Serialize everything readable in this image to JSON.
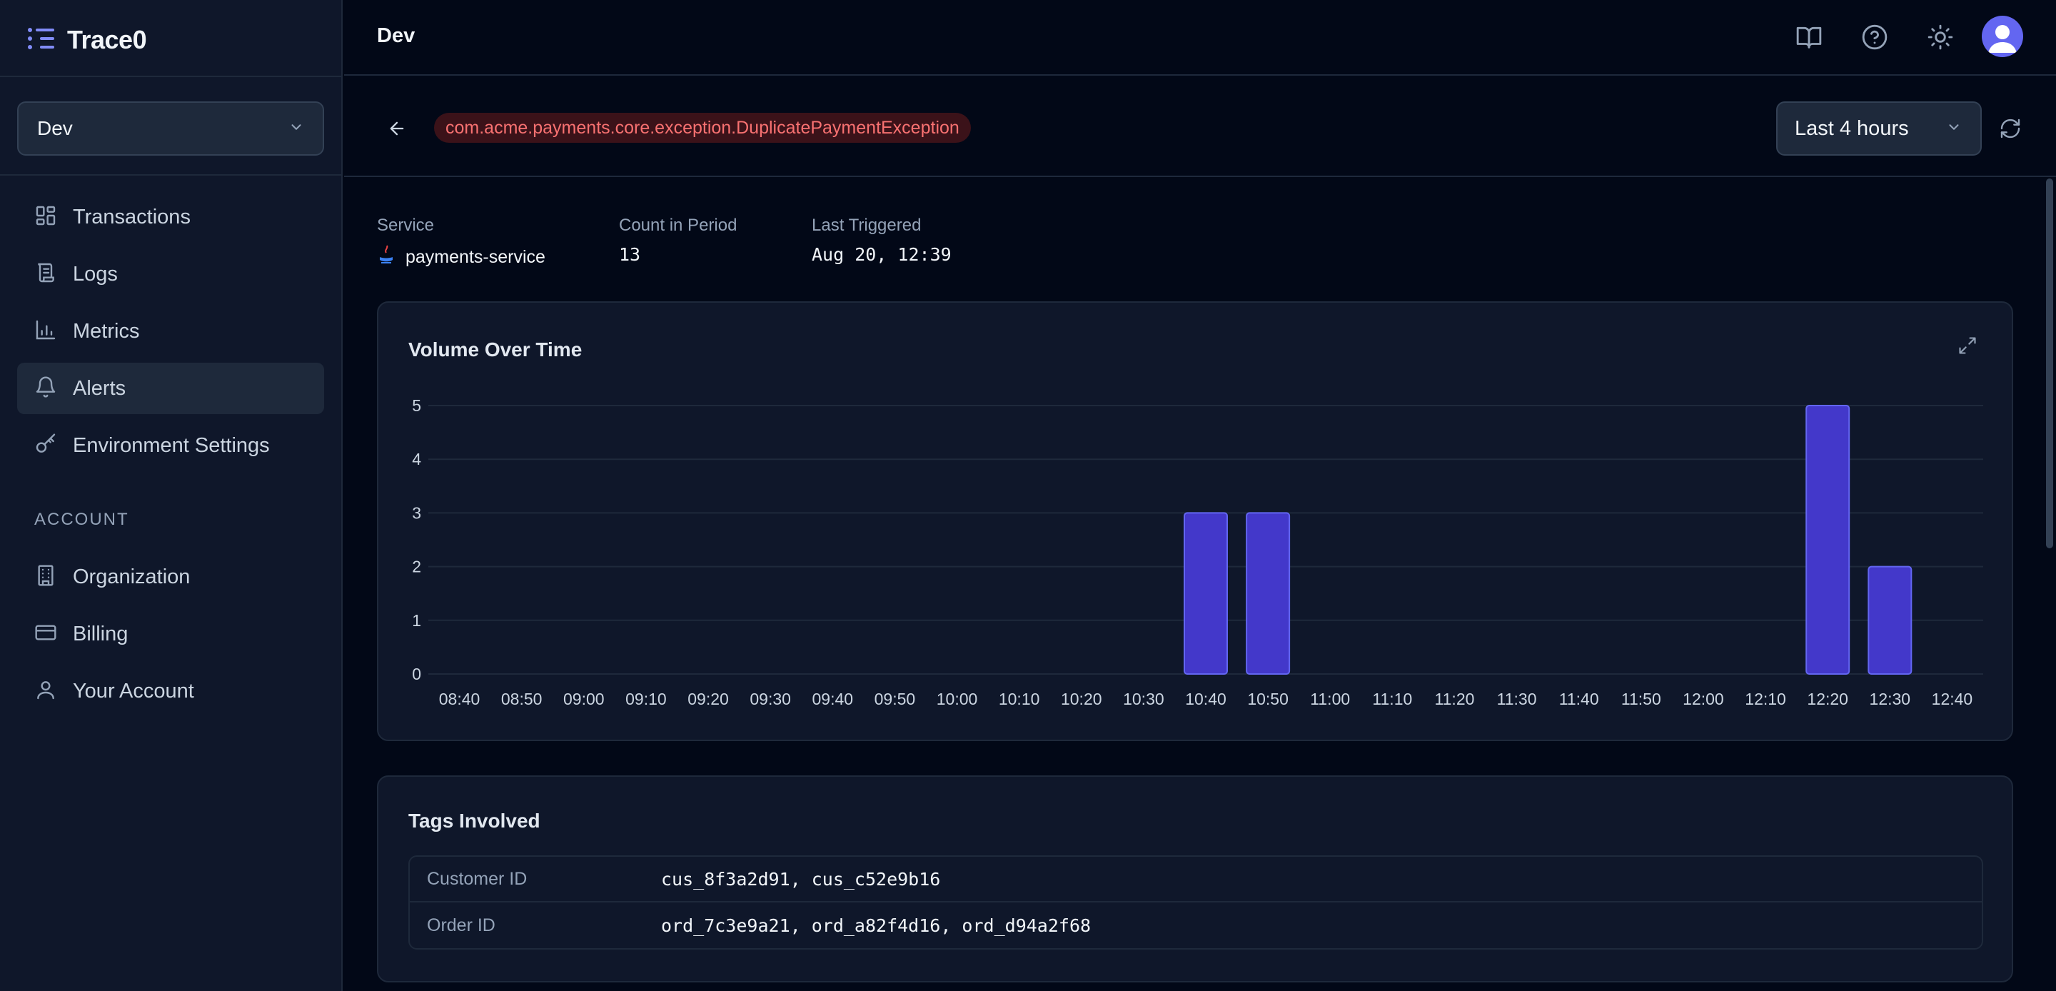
{
  "app": {
    "name": "Trace0"
  },
  "sidebar": {
    "environment": "Dev",
    "items": [
      {
        "label": "Transactions",
        "icon": "dashboard-icon",
        "active": false
      },
      {
        "label": "Logs",
        "icon": "scroll-icon",
        "active": false
      },
      {
        "label": "Metrics",
        "icon": "bar-chart-icon",
        "active": false
      },
      {
        "label": "Alerts",
        "icon": "bell-icon",
        "active": true
      },
      {
        "label": "Environment Settings",
        "icon": "key-icon",
        "active": false
      }
    ],
    "account_label": "ACCOUNT",
    "account_items": [
      {
        "label": "Organization",
        "icon": "building-icon"
      },
      {
        "label": "Billing",
        "icon": "credit-card-icon"
      },
      {
        "label": "Your Account",
        "icon": "user-icon"
      }
    ]
  },
  "header": {
    "title": "Dev",
    "icons": [
      "book-icon",
      "help-icon",
      "sun-icon",
      "avatar"
    ]
  },
  "detail": {
    "exception": "com.acme.payments.core.exception.DuplicatePaymentException",
    "time_range": "Last 4 hours",
    "service_label": "Service",
    "service": "payments-service",
    "count_label": "Count in Period",
    "count": "13",
    "last_label": "Last Triggered",
    "last": "Aug 20, 12:39"
  },
  "chart_card": {
    "title": "Volume Over Time"
  },
  "chart_data": {
    "type": "bar",
    "title": "Volume Over Time",
    "categories": [
      "08:40",
      "08:50",
      "09:00",
      "09:10",
      "09:20",
      "09:30",
      "09:40",
      "09:50",
      "10:00",
      "10:10",
      "10:20",
      "10:30",
      "10:40",
      "10:50",
      "11:00",
      "11:10",
      "11:20",
      "11:30",
      "11:40",
      "11:50",
      "12:00",
      "12:10",
      "12:20",
      "12:30",
      "12:40"
    ],
    "values": [
      0,
      0,
      0,
      0,
      0,
      0,
      0,
      0,
      0,
      0,
      0,
      0,
      3,
      3,
      0,
      0,
      0,
      0,
      0,
      0,
      0,
      0,
      5,
      2,
      0
    ],
    "yticks": [
      0,
      1,
      2,
      3,
      4,
      5
    ],
    "ylim": [
      0,
      5
    ],
    "grid": true,
    "bar_color": "#4338ca",
    "bar_border": "#6366f1"
  },
  "tags": {
    "title": "Tags Involved",
    "rows": [
      {
        "key": "Customer ID",
        "value": "cus_8f3a2d91, cus_c52e9b16"
      },
      {
        "key": "Order ID",
        "value": "ord_7c3e9a21, ord_a82f4d16, ord_d94a2f68"
      }
    ]
  },
  "colors": {
    "background": "#020817",
    "panel": "#0f172a",
    "border": "#1e293b",
    "accent": "#6366f1",
    "danger": "#f87171"
  }
}
